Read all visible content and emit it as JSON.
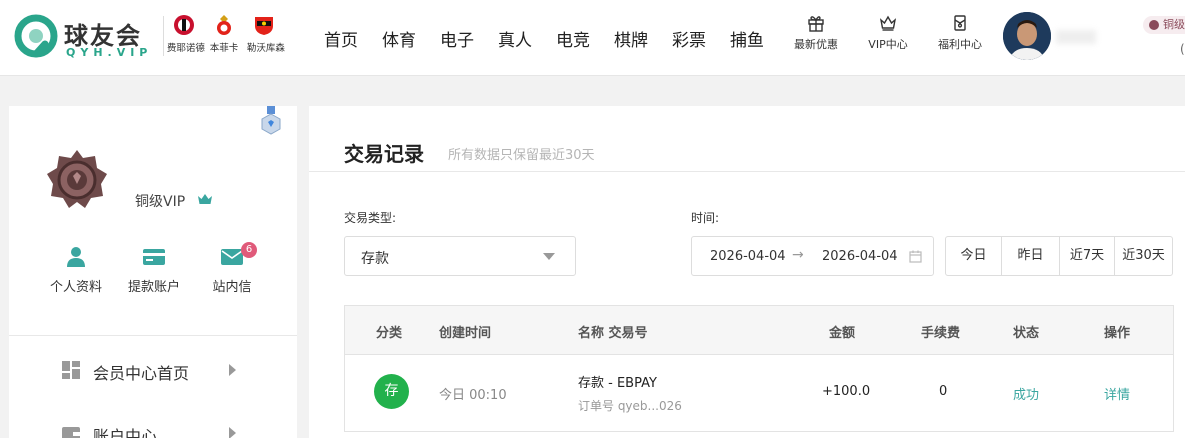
{
  "brand": {
    "title": "球友会",
    "subtitle": "QYH.VIP"
  },
  "clubs": [
    {
      "name": "费耶诺德"
    },
    {
      "name": "本菲卡"
    },
    {
      "name": "勒沃库森"
    }
  ],
  "nav": [
    "首页",
    "体育",
    "电子",
    "真人",
    "电竞",
    "棋牌",
    "彩票",
    "捕鱼"
  ],
  "quick_links": [
    {
      "label": "最新优惠",
      "icon": "gift-icon"
    },
    {
      "label": "VIP中心",
      "icon": "crown-icon"
    },
    {
      "label": "福利中心",
      "icon": "welfare-icon"
    }
  ],
  "user": {
    "level_chip": "铜级",
    "paren": "("
  },
  "sidebar": {
    "vip_name": "铜级VIP",
    "shortcuts": [
      {
        "label": "个人资料",
        "icon": "profile-icon"
      },
      {
        "label": "提款账户",
        "icon": "card-icon"
      },
      {
        "label": "站内信",
        "icon": "mail-icon",
        "badge": "6"
      }
    ],
    "menu": [
      {
        "label": "会员中心首页",
        "icon": "dashboard-icon"
      },
      {
        "label": "账户中心",
        "icon": "wallet-icon"
      }
    ]
  },
  "main": {
    "title": "交易记录",
    "subtitle": "所有数据只保留最近30天",
    "filters": {
      "type_label": "交易类型:",
      "type_value": "存款",
      "time_label": "时间:",
      "date_start": "2026-04-04",
      "date_sep": "→",
      "date_end": "2026-04-04",
      "quick": [
        "今日",
        "昨日",
        "近7天",
        "近30天"
      ]
    },
    "table": {
      "headers": [
        "分类",
        "创建时间",
        "名称 交易号",
        "金额",
        "手续费",
        "状态",
        "操作"
      ],
      "rows": [
        {
          "type_badge": "存",
          "created": "今日 00:10",
          "name": "存款 - EBPAY",
          "order": "订单号 qyeb...026",
          "amount": "+100.0",
          "fee": "0",
          "status": "成功",
          "action": "详情"
        }
      ]
    }
  },
  "colors": {
    "accent": "#2aa58b",
    "success": "#22b14c",
    "status": "#3aa6a0"
  }
}
